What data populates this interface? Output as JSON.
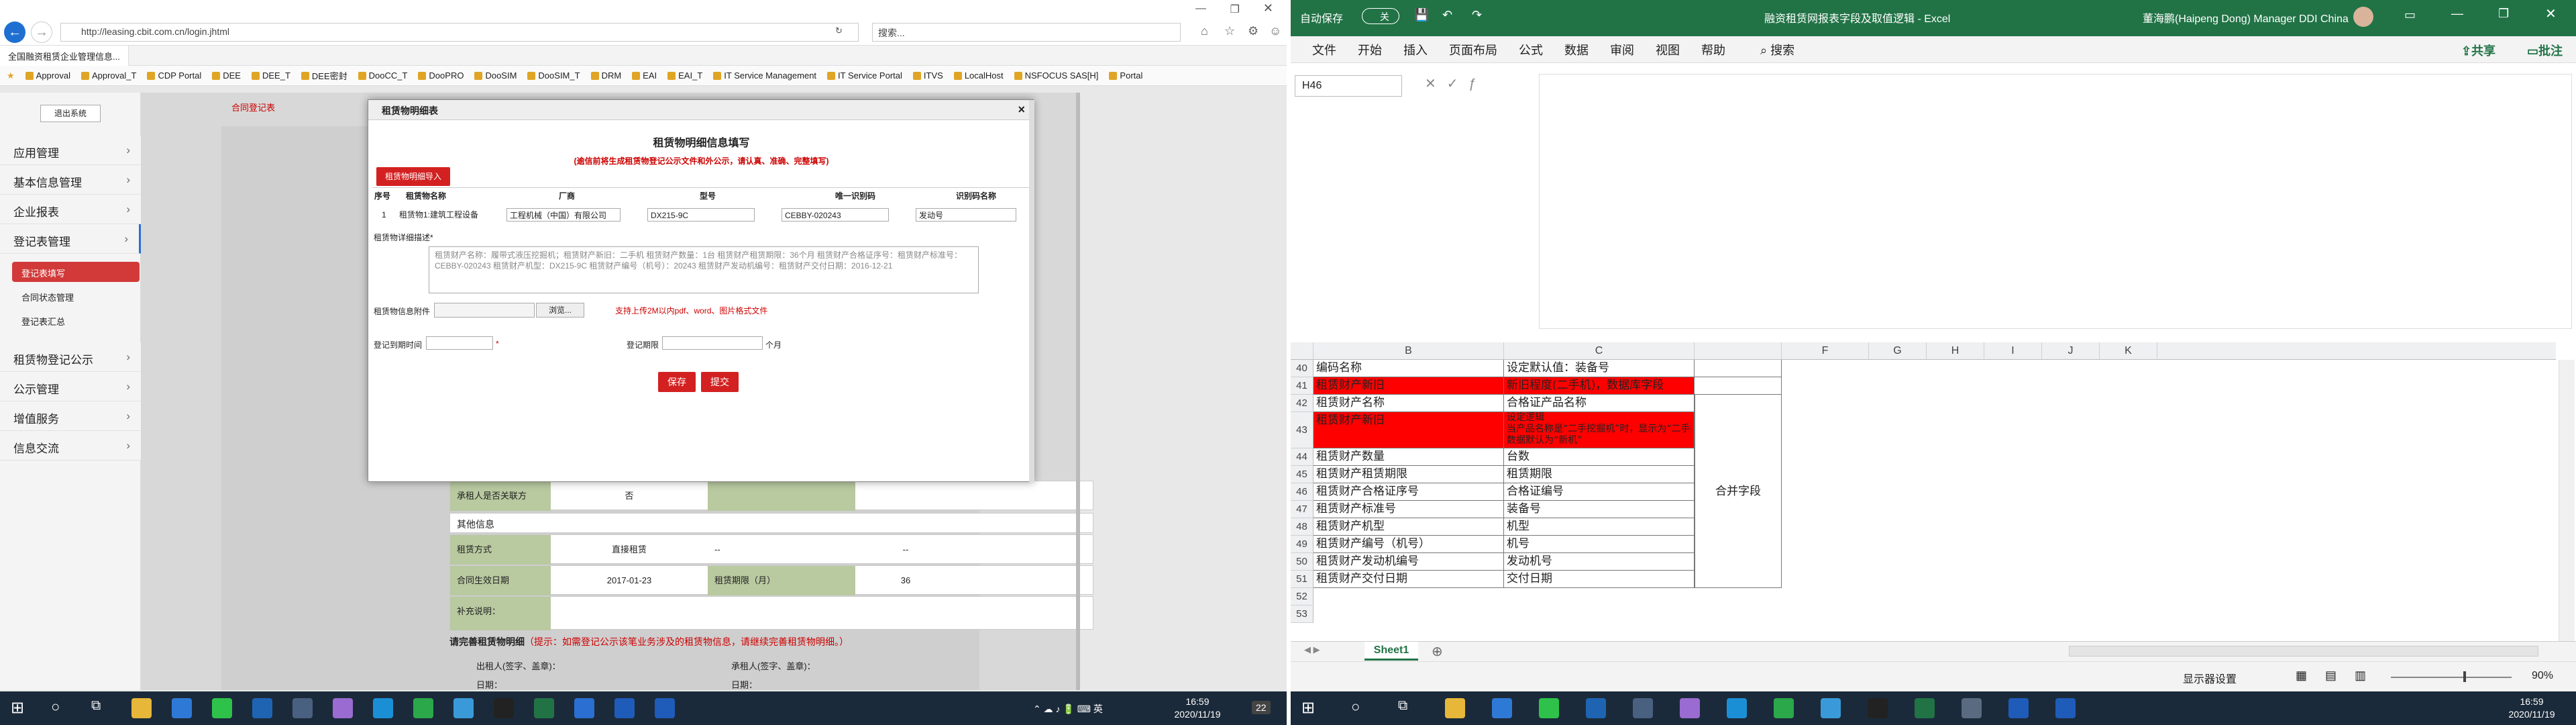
{
  "ie": {
    "title": "http://leasing.cbit.com.cn/login.jhtml",
    "search_placeholder": "搜索...",
    "tab_label": "全国融资租赁企业管理信息...",
    "favorites": [
      "Approval",
      "Approval_T",
      "CDP Portal",
      "DEE",
      "DEE_T",
      "DEE密封",
      "DooCC_T",
      "DooPRO",
      "DooSIM",
      "DooSIM_T",
      "DRM",
      "EAI",
      "EAI_T",
      "IT Service Management",
      "IT Service Portal",
      "ITVS",
      "LocalHost",
      "NSFOCUS SAS[H]",
      "Portal"
    ],
    "logout": "退出系统",
    "nav": [
      "应用管理",
      "基本信息管理",
      "企业报表",
      "登记表管理"
    ],
    "subnav": [
      "登记表填写",
      "合同状态管理",
      "登记表汇总"
    ],
    "nav2": [
      "租赁物登记公示",
      "公示管理",
      "增值服务",
      "信息交流"
    ],
    "page_link": "合同登记表",
    "rows": [
      {
        "a": "承租人是否关联方",
        "b": "否",
        "c": "",
        "d": ""
      },
      {
        "a": "其他信息",
        "b": "",
        "c": "",
        "d": ""
      },
      {
        "a": "租赁方式",
        "b": "直接租赁",
        "c": "--",
        "d": "--"
      },
      {
        "a": "合同生效日期",
        "b": "2017-01-23",
        "c": "租赁期限（月）",
        "d": "36"
      },
      {
        "a": "补充说明：",
        "b": "",
        "c": "",
        "d": ""
      }
    ],
    "complete_label": "请完善租赁物明细",
    "complete_hint": "（提示：如需登记公示该笔业务涉及的租赁物信息，请继续完善租赁物明细。）",
    "sign_left": "出租人(签字、盖章)：",
    "sign_right": "承租人(签字、盖章)：",
    "date_left": "日期：",
    "date_right": "日期："
  },
  "modal": {
    "header": "租赁物明细表",
    "title": "租赁物明细信息填写",
    "note": "(逾信前将生成租赁物登记公示文件和外公示，请认真、准确、完整填写)",
    "import_btn": "租赁物明细导入",
    "cols": [
      "序号",
      "租赁物名称",
      "厂商",
      "型号",
      "唯一识别码",
      "识别码名称"
    ],
    "row": {
      "no": "1",
      "name": "租赁物1:建筑工程设备",
      "maker": "工程机械（中国）有限公司",
      "model": "DX215-9C",
      "code": "CEBBY-020243",
      "codename": "发动号"
    },
    "desc_label": "租赁物详细描述*",
    "desc_text": "租赁财产名称：履带式液压挖掘机；租赁财产新旧：二手机 租赁财产数量：1台 租赁财产租赁期限：36个月 租赁财产合格证序号：租赁财产标准号：CEBBY-020243 租赁财产机型：DX215-9C 租赁财产编号（机号）：20243 租赁财产发动机编号：租赁财产交付日期：2016-12-21",
    "attach_label": "租赁物信息附件",
    "browse": "浏览...",
    "attach_hint": "支持上传2M以内pdf、word、图片格式文件",
    "start_label": "登记到期时间",
    "period_label": "登记期限",
    "unit": "个月",
    "save": "保存",
    "submit": "提交"
  },
  "taskbar_left": {
    "time": "16:59",
    "date": "2020/11/19",
    "badge": "22"
  },
  "excel": {
    "autosave": "自动保存",
    "autosave_state": "关",
    "title": "融资租赁网报表字段及取值逻辑 - Excel",
    "user": "董海鹏(Haipeng Dong) Manager DDI China",
    "menus": [
      "文件",
      "开始",
      "插入",
      "页面布局",
      "公式",
      "数据",
      "审阅",
      "视图",
      "帮助"
    ],
    "search": "搜索",
    "share": "共享",
    "comment": "批注",
    "namebox": "H46",
    "cols": [
      "B",
      "C",
      "",
      "F",
      "G",
      "H",
      "I",
      "J",
      "K"
    ],
    "rows": [
      {
        "n": "40",
        "b": "编码名称",
        "c": "设定默认值：装备号",
        "red": false
      },
      {
        "n": "41",
        "b": "租赁财产新旧",
        "c": "新旧程度(二手机)，数据库字段",
        "red": true
      },
      {
        "n": "42",
        "b": "租赁财产名称",
        "c": "合格证产品名称",
        "red": false
      },
      {
        "n": "43",
        "b": "租赁财产新旧",
        "c": "设定逻辑",
        "c2": "当产品名称是“二手挖掘机”时，显示为“二手挖”，指此之外都显示",
        "c3": "数据默认为“新机”",
        "red": true,
        "tall": true
      },
      {
        "n": "44",
        "b": "租赁财产数量",
        "c": "台数",
        "red": false
      },
      {
        "n": "45",
        "b": "租赁财产租赁期限",
        "c": "租赁期限",
        "red": false
      },
      {
        "n": "46",
        "b": "租赁财产合格证序号",
        "c": "合格证编号",
        "red": false
      },
      {
        "n": "47",
        "b": "租赁财产标准号",
        "c": "装备号",
        "red": false
      },
      {
        "n": "48",
        "b": "租赁财产机型",
        "c": "机型",
        "red": false
      },
      {
        "n": "49",
        "b": "租赁财产编号（机号）",
        "c": "机号",
        "red": false
      },
      {
        "n": "50",
        "b": "租赁财产发动机编号",
        "c": "发动机号",
        "red": false
      },
      {
        "n": "51",
        "b": "租赁财产交付日期",
        "c": "交付日期",
        "red": false
      },
      {
        "n": "52",
        "b": "",
        "c": "",
        "red": false
      },
      {
        "n": "53",
        "b": "",
        "c": "",
        "red": false
      }
    ],
    "merged": "合并字段",
    "sheet": "Sheet1",
    "display_settings": "显示器设置",
    "zoom": "90%"
  },
  "taskbar_right": {
    "time": "16:59",
    "date": "2020/11/19"
  }
}
